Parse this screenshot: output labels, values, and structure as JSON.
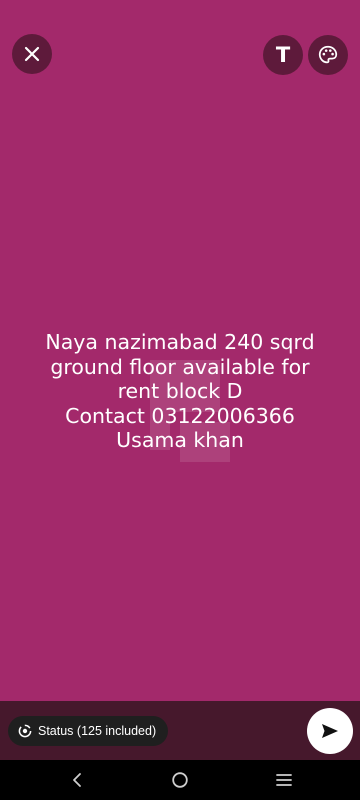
{
  "canvas": {
    "background_color": "#a3296b",
    "text": "Naya nazimabad 240 sqrd\nground floor available for\nrent block D\nContact 03122006366\nUsama khan",
    "text_color": "#ffffff"
  },
  "top_bar": {
    "close_icon": "close-icon",
    "text_tool_label": "T",
    "palette_icon": "palette-icon"
  },
  "bottom_bar": {
    "audience_label": "Status (125 included)",
    "audience_icon": "status-icon",
    "send_icon": "send-icon",
    "background_color": "#46182c"
  },
  "nav": {
    "back_icon": "back-icon",
    "home_icon": "home-icon",
    "recents_icon": "recents-icon"
  }
}
